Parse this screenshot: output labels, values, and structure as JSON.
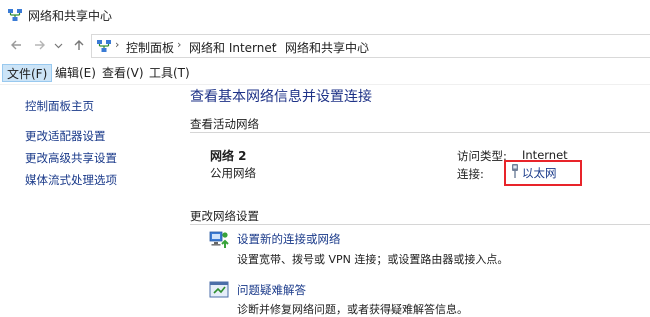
{
  "window": {
    "title": "网络和共享中心"
  },
  "nav": {
    "back_icon": "arrow-left-icon",
    "forward_icon": "arrow-right-icon",
    "recent_icon": "chevron-down-icon",
    "up_icon": "arrow-up-icon"
  },
  "breadcrumb": [
    "控制面板",
    "网络和 Internet",
    "网络和共享中心"
  ],
  "menu": [
    {
      "label": "文件(F)",
      "active": true
    },
    {
      "label": "编辑(E)"
    },
    {
      "label": "查看(V)"
    },
    {
      "label": "工具(T)"
    }
  ],
  "left_pane": {
    "items": [
      "控制面板主页",
      "更改适配器设置",
      "更改高级共享设置",
      "媒体流式处理选项"
    ]
  },
  "main": {
    "heading": "查看基本网络信息并设置连接",
    "active_networks_label": "查看活动网络",
    "network": {
      "name": "网络 2",
      "category": "公用网络",
      "access_type_label": "访问类型:",
      "access_type_value": "Internet",
      "connection_label": "连接:",
      "connection_value": "以太网"
    },
    "change_settings_label": "更改网络设置",
    "tasks": [
      {
        "icon": "new-connection-icon",
        "title": "设置新的连接或网络",
        "desc": "设置宽带、拨号或 VPN 连接；或设置路由器或接入点。"
      },
      {
        "icon": "troubleshoot-icon",
        "title": "问题疑难解答",
        "desc": "诊断并修复网络问题，或者获得疑难解答信息。"
      }
    ]
  },
  "colors": {
    "link": "#1a3a8a",
    "heading": "#1e3287",
    "highlight": "#e8242a",
    "menu_active": "#cce4f7"
  }
}
